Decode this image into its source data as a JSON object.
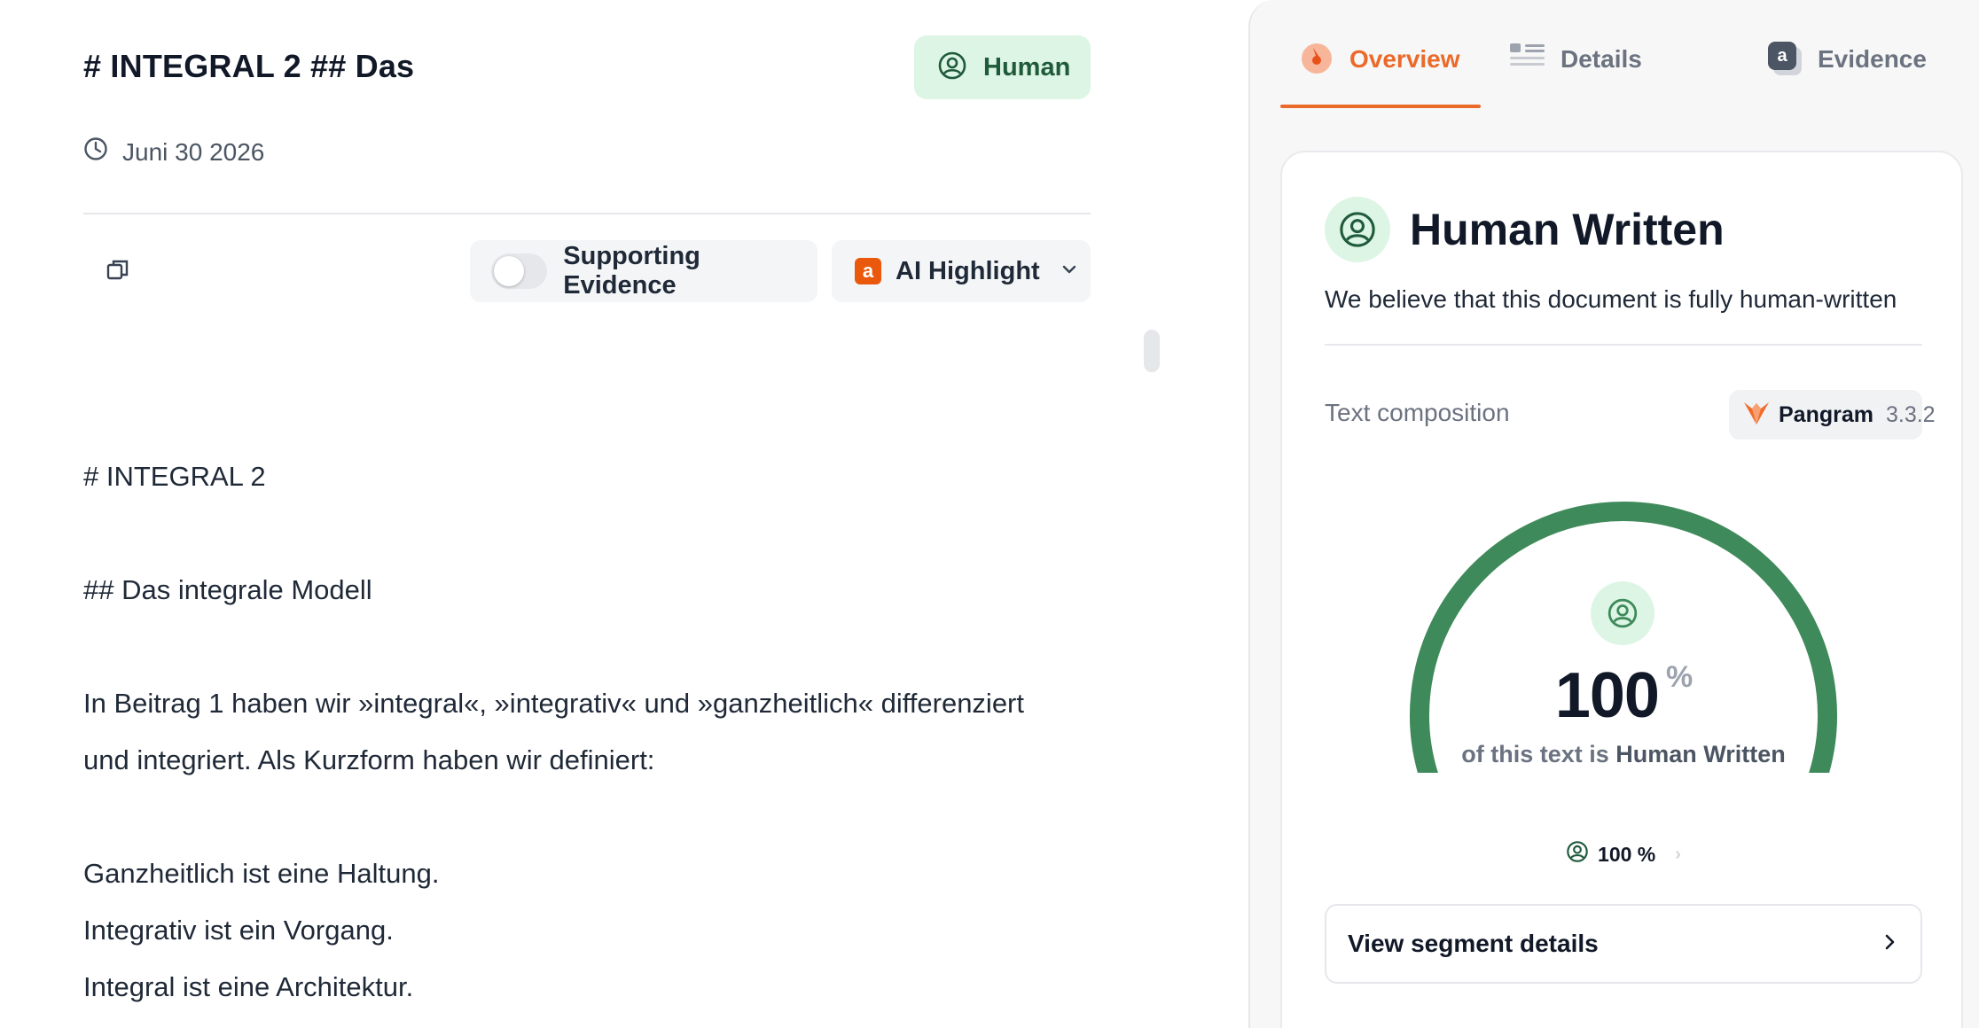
{
  "document": {
    "title": "# INTEGRAL 2 ## Das",
    "badge_label": "Human",
    "date": "Juni 30 2026",
    "toolbar": {
      "supporting_evidence_label": "Supporting Evidence",
      "ai_highlight_label": "AI Highlight",
      "ai_highlight_badge": "a"
    },
    "body": [
      "# INTEGRAL 2",
      "## Das integrale Modell",
      "In Beitrag 1 haben wir »integral«, »integrativ« und »ganzheitlich« differenziert",
      "und integriert. Als Kurzform haben wir definiert:",
      "Ganzheitlich ist eine Haltung.",
      "Integrativ ist ein Vorgang.",
      "Integral ist eine Architektur."
    ]
  },
  "sidebar": {
    "tabs": [
      {
        "label": "Overview",
        "icon": "gauge-icon",
        "active": true
      },
      {
        "label": "Details",
        "icon": "list-icon",
        "active": false
      },
      {
        "label": "Evidence",
        "icon": "evidence-icon",
        "badge": "a",
        "active": false
      }
    ],
    "card": {
      "title": "Human Written",
      "description": "We believe that this document is fully human-written",
      "text_composition_label": "Text composition",
      "model_name": "Pangram",
      "model_version": "3.3.2",
      "score_value": "100",
      "score_unit": "%",
      "score_fraction": 1.0,
      "caption_prefix": "of this text is",
      "caption_strong": "Human Written",
      "mini_value": "100 %",
      "segment_button_label": "View segment details"
    },
    "colors": {
      "accent": "#ea6a2a",
      "human_green": "#3f8a5a",
      "human_bg": "#dcf5e4"
    }
  }
}
